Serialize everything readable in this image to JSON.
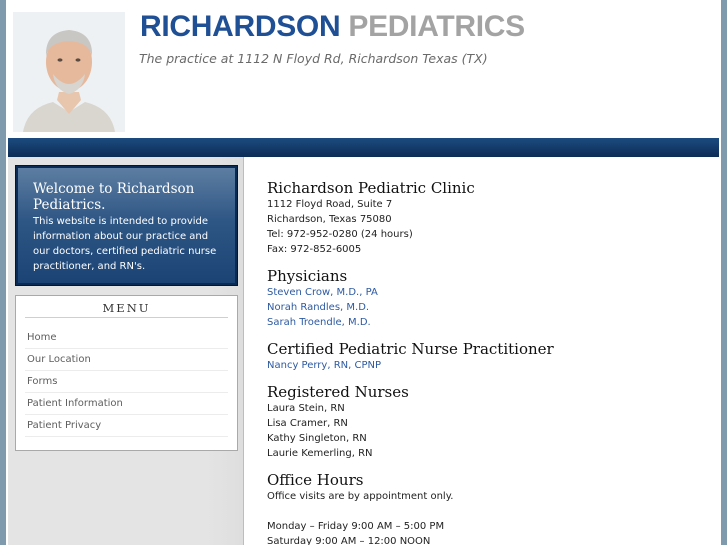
{
  "header": {
    "title_part1": "RICHARDSON",
    "title_part2": "PEDIATRICS",
    "tagline": "The practice at 1112 N Floyd Rd, Richardson Texas (TX)"
  },
  "welcome": {
    "title": "Welcome to Richardson Pediatrics.",
    "text": "This website is intended to provide information about our practice and our doctors, certified pediatric nurse practitioner, and RN's."
  },
  "menu": {
    "title": "MENU",
    "items": [
      {
        "label": "Home"
      },
      {
        "label": "Our Location"
      },
      {
        "label": "Forms"
      },
      {
        "label": "Patient Information"
      },
      {
        "label": "Patient Privacy"
      }
    ]
  },
  "clinic": {
    "heading": "Richardson Pediatric Clinic",
    "address1": "1112 Floyd Road, Suite 7",
    "address2": "Richardson, Texas 75080",
    "tel": "Tel: 972-952-0280 (24 hours)",
    "fax": "Fax: 972-852-6005"
  },
  "physicians": {
    "heading": "Physicians",
    "list": [
      "Steven Crow, M.D., PA",
      "Norah Randles, M.D.",
      "Sarah Troendle, M.D."
    ]
  },
  "cpnp": {
    "heading": "Certified Pediatric Nurse Practitioner",
    "list": [
      "Nancy Perry, RN, CPNP"
    ]
  },
  "nurses": {
    "heading": "Registered Nurses",
    "list": [
      "Laura Stein, RN",
      "Lisa Cramer, RN",
      "Kathy Singleton, RN",
      "Laurie Kemerling, RN"
    ]
  },
  "hours": {
    "heading": "Office Hours",
    "note": "Office visits are by appointment only.",
    "weekday": "Monday – Friday 9:00 AM – 5:00 PM",
    "saturday": "Saturday 9:00 AM – 12:00 NOON"
  },
  "colors": {
    "title_blue": "#1f4f94",
    "title_gray": "#a3a3a3",
    "navbar": "#0c2d55",
    "link": "#2d5aa2"
  }
}
